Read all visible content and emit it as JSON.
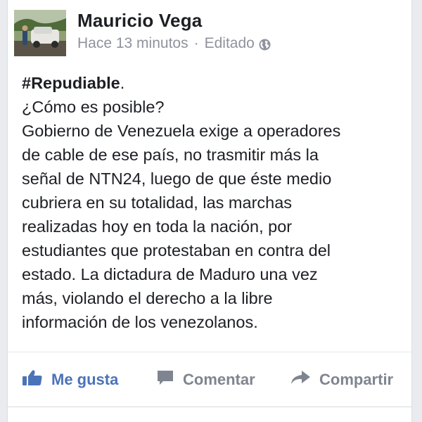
{
  "post": {
    "author": "Mauricio Vega",
    "time": "Hace 13 minutos",
    "separator": "·",
    "edited": "Editado",
    "privacy_icon": "globe-icon",
    "hashtag": "#Repudiable",
    "hashtag_period": ".",
    "lines": [
      "¿Cómo es posible?",
      "Gobierno de Venezuela exige a operadores",
      "de cable de ese país, no trasmitir más la",
      "señal de NTN24, luego de que éste medio",
      "cubriera en su totalidad, las marchas",
      "realizadas  hoy en toda la nación, por",
      "estudiantes que protestaban en contra del",
      "estado. La dictadura de Maduro una vez",
      "más, violando el derecho a la libre",
      "información de los venezolanos."
    ]
  },
  "actions": {
    "like": "Me gusta",
    "comment": "Comentar",
    "share": "Compartir"
  },
  "colors": {
    "like_blue": "#4b73b8",
    "muted_gray": "#7f8590",
    "meta_gray": "#8e939c",
    "text": "#1d1f24"
  }
}
